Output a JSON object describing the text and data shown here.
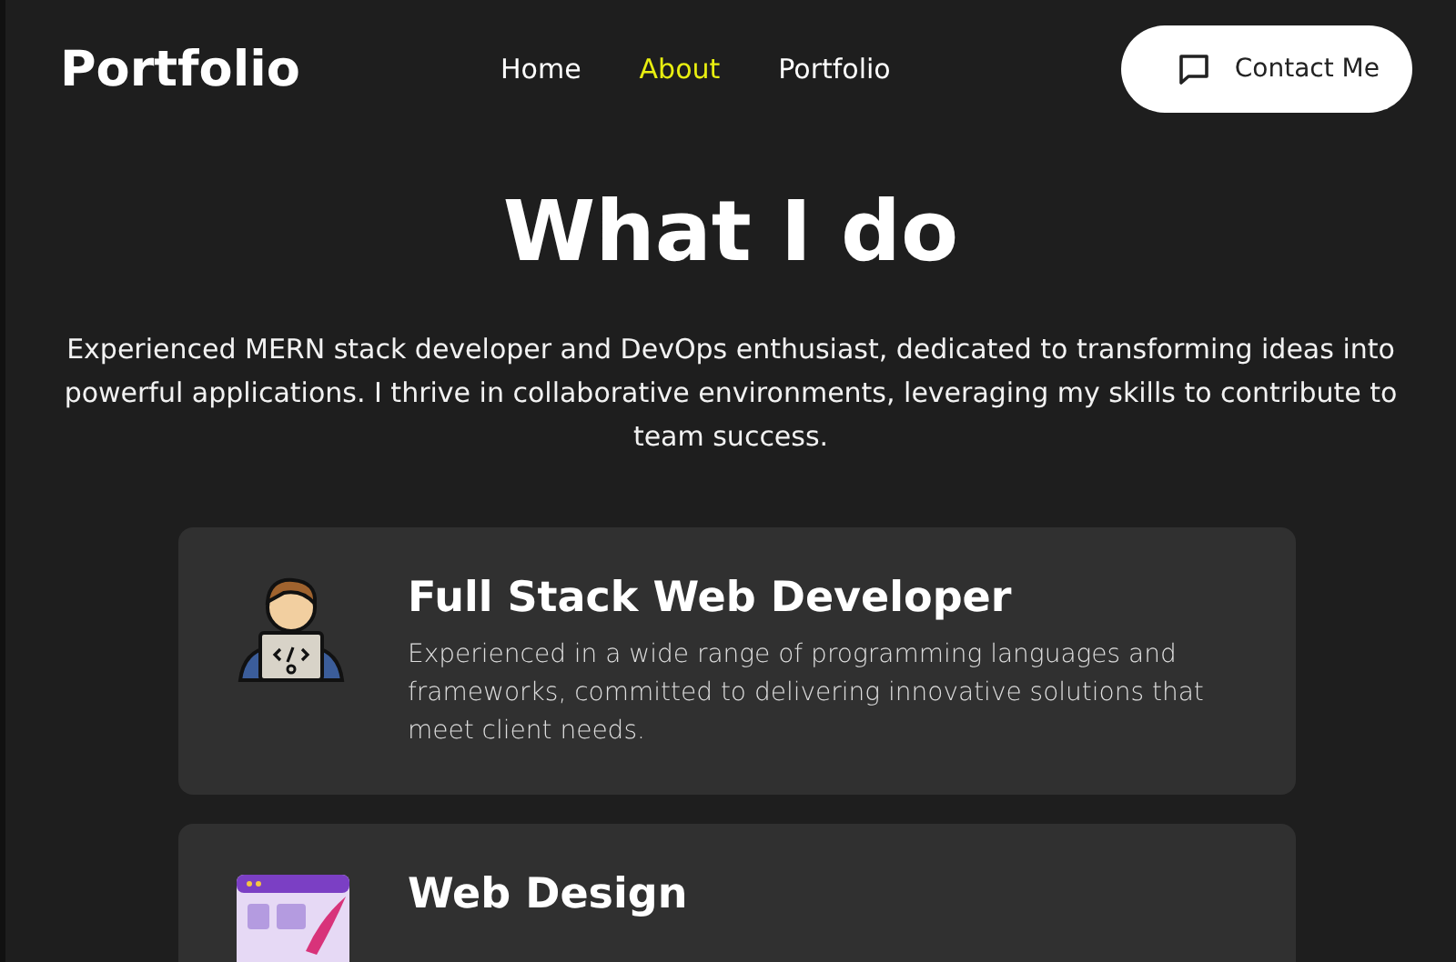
{
  "header": {
    "logo": "Portfolio",
    "nav": [
      {
        "label": "Home",
        "selected": false
      },
      {
        "label": "About",
        "selected": true
      },
      {
        "label": "Portfolio",
        "selected": false
      }
    ],
    "contact_button": "Contact Me"
  },
  "hero": {
    "title": "What I do",
    "text": "Experienced MERN stack developer and DevOps enthusiast, dedicated to transforming ideas into powerful applications. I thrive in collaborative environments, leveraging my skills to contribute to team success."
  },
  "services": [
    {
      "kind": "developer",
      "title": "Full Stack Web Developer",
      "text": "Experienced in a wide range of programming languages and frameworks, committed to delivering innovative solutions that meet client needs."
    },
    {
      "kind": "design",
      "title": "Web Design"
    }
  ]
}
